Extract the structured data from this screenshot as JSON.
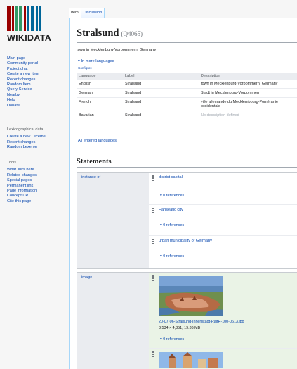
{
  "logo": {
    "text": "WIKIDATA",
    "bar_colors": [
      "#990000",
      "#990000",
      "#339966",
      "#339966",
      "#990000",
      "#006699",
      "#006699",
      "#006699",
      "#006699"
    ]
  },
  "nav_main": [
    "Main page",
    "Community portal",
    "Project chat",
    "Create a new Item",
    "Recent changes",
    "Random Item",
    "Query Service",
    "Nearby",
    "Help",
    "Donate"
  ],
  "nav_lexeme": {
    "heading": "Lexicographical data",
    "items": [
      "Create a new Lexeme",
      "Recent changes",
      "Random Lexeme"
    ]
  },
  "nav_tools": {
    "heading": "Tools",
    "items": [
      "What links here",
      "Related changes",
      "Special pages",
      "Permanent link",
      "Page information",
      "Concept URI",
      "Cite this page"
    ]
  },
  "tabs": [
    "Item",
    "Discussion"
  ],
  "entity": {
    "title": "Stralsund",
    "qid": "(Q4065)",
    "description": "town in Mecklenburg-Vorpommern, Germany"
  },
  "languages": {
    "more_link": "In more languages",
    "configure": "Configure",
    "headers": [
      "Language",
      "Label",
      "Description"
    ],
    "rows": [
      {
        "language": "English",
        "label": "Stralsund",
        "description": "town in Mecklenburg-Vorpommern, Germany"
      },
      {
        "language": "German",
        "label": "Stralsund",
        "description": "Stadt in Mecklenburg-Vorpommern"
      },
      {
        "language": "French",
        "label": "Stralsund",
        "description": "ville allemande du Mecklembourg-Poméranie occidentale"
      },
      {
        "language": "Bavarian",
        "label": "Stralsund",
        "description": "No description defined"
      }
    ],
    "all_entered": "All entered languages"
  },
  "statements": {
    "heading": "Statements",
    "instance_of": {
      "property": "instance of",
      "values": [
        "district capital",
        "Hanseatic city",
        "urban municipality of Germany"
      ],
      "refs": "0 references"
    },
    "image": {
      "property": "image",
      "file": "20-07-06-Stralsund-Innenstadt-RalfR-100-0613.jpg",
      "meta": "8,534 × 4,351; 19.36 MB",
      "refs": "0 references"
    }
  },
  "colors": {
    "link": "#0645ad",
    "border": "#a7d7f9",
    "image_bg": "#eaf3e6"
  }
}
